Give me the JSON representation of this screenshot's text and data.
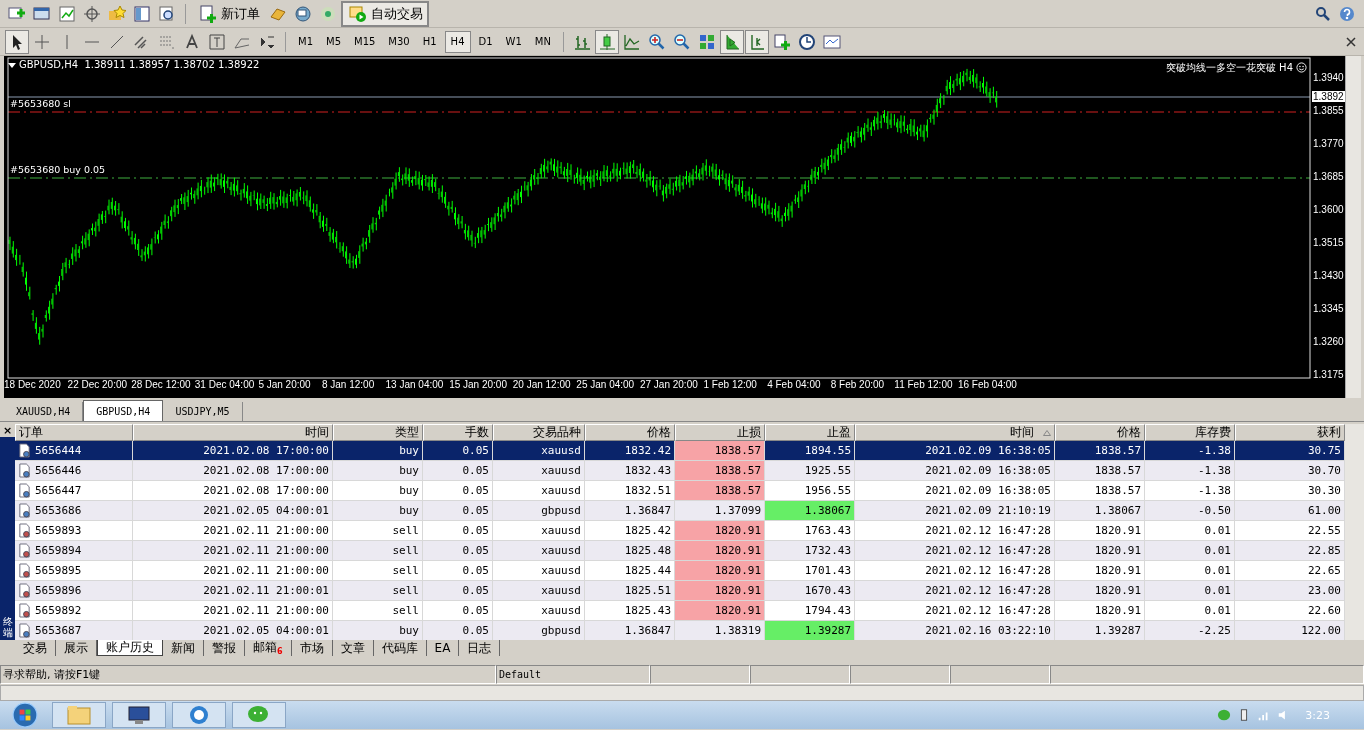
{
  "toolbar": {
    "new_order": "新订单",
    "auto_trading": {
      "label": "自动交易",
      "on": true
    }
  },
  "timeframes": [
    {
      "label": "M1",
      "selected": false
    },
    {
      "label": "M5",
      "selected": false
    },
    {
      "label": "M15",
      "selected": false
    },
    {
      "label": "M30",
      "selected": false
    },
    {
      "label": "H1",
      "selected": false
    },
    {
      "label": "H4",
      "selected": true
    },
    {
      "label": "D1",
      "selected": false
    },
    {
      "label": "W1",
      "selected": false
    },
    {
      "label": "MN",
      "selected": false
    }
  ],
  "chart": {
    "title": "GBPUSD,H4",
    "ohlc": "1.38911 1.38957 1.38702 1.38922",
    "indicator": "突破均线一多空一花突破 H4",
    "order_lines": [
      {
        "label": "#5653680 sl",
        "kind": "sl"
      },
      {
        "label": "#5653680 buy 0.05",
        "kind": "entry"
      }
    ],
    "price_labels": [
      {
        "label": "1.3940",
        "current": false
      },
      {
        "label": "1.3892",
        "current": true
      },
      {
        "label": "1.3855",
        "current": false
      },
      {
        "label": "1.3770",
        "current": false
      },
      {
        "label": "1.3685",
        "current": false
      },
      {
        "label": "1.3600",
        "current": false
      },
      {
        "label": "1.3515",
        "current": false
      },
      {
        "label": "1.3430",
        "current": false
      },
      {
        "label": "1.3345",
        "current": false
      },
      {
        "label": "1.3260",
        "current": false
      },
      {
        "label": "1.3175",
        "current": false
      }
    ],
    "time_labels": [
      "18 Dec 2020",
      "22 Dec 20:00",
      "28 Dec 12:00",
      "31 Dec 04:00",
      "5 Jan 20:00",
      "8 Jan 12:00",
      "13 Jan 04:00",
      "15 Jan 20:00",
      "20 Jan 12:00",
      "25 Jan 04:00",
      "27 Jan 20:00",
      "1 Feb 12:00",
      "4 Feb 04:00",
      "8 Feb 20:00",
      "11 Feb 12:00",
      "16 Feb 04:00"
    ]
  },
  "chart_tabs": [
    {
      "label": "XAUUSD,H4",
      "selected": false
    },
    {
      "label": "GBPUSD,H4",
      "selected": true
    },
    {
      "label": "USDJPY,M5",
      "selected": false
    }
  ],
  "terminal": {
    "close": "×",
    "label": "终端"
  },
  "table": {
    "columns": [
      {
        "label": "订单",
        "sorted": false
      },
      {
        "label": "时间",
        "sorted": false
      },
      {
        "label": "类型",
        "sorted": false
      },
      {
        "label": "手数",
        "sorted": false
      },
      {
        "label": "交易品种",
        "sorted": false
      },
      {
        "label": "价格",
        "sorted": false
      },
      {
        "label": "止损",
        "sorted": false
      },
      {
        "label": "止盈",
        "sorted": false
      },
      {
        "label": "时间",
        "sorted": true
      },
      {
        "label": "价格",
        "sorted": false
      },
      {
        "label": "库存费",
        "sorted": false
      },
      {
        "label": "获利",
        "sorted": false
      }
    ],
    "rows": [
      {
        "kind": "buy",
        "selected": true,
        "sl_hit": true,
        "tp_hit": false,
        "cells": [
          "5656444",
          "2021.02.08 17:00:00",
          "buy",
          "0.05",
          "xauusd",
          "1832.42",
          "1838.57",
          "1894.55",
          "2021.02.09 16:38:05",
          "1838.57",
          "-1.38",
          "30.75"
        ]
      },
      {
        "kind": "buy",
        "selected": false,
        "sl_hit": true,
        "tp_hit": false,
        "cells": [
          "5656446",
          "2021.02.08 17:00:00",
          "buy",
          "0.05",
          "xauusd",
          "1832.43",
          "1838.57",
          "1925.55",
          "2021.02.09 16:38:05",
          "1838.57",
          "-1.38",
          "30.70"
        ]
      },
      {
        "kind": "buy",
        "selected": false,
        "sl_hit": true,
        "tp_hit": false,
        "cells": [
          "5656447",
          "2021.02.08 17:00:00",
          "buy",
          "0.05",
          "xauusd",
          "1832.51",
          "1838.57",
          "1956.55",
          "2021.02.09 16:38:05",
          "1838.57",
          "-1.38",
          "30.30"
        ]
      },
      {
        "kind": "buy",
        "selected": false,
        "sl_hit": false,
        "tp_hit": true,
        "cells": [
          "5653686",
          "2021.02.05 04:00:01",
          "buy",
          "0.05",
          "gbpusd",
          "1.36847",
          "1.37099",
          "1.38067",
          "2021.02.09 21:10:19",
          "1.38067",
          "-0.50",
          "61.00"
        ]
      },
      {
        "kind": "sell",
        "selected": false,
        "sl_hit": true,
        "tp_hit": false,
        "cells": [
          "5659893",
          "2021.02.11 21:00:00",
          "sell",
          "0.05",
          "xauusd",
          "1825.42",
          "1820.91",
          "1763.43",
          "2021.02.12 16:47:28",
          "1820.91",
          "0.01",
          "22.55"
        ]
      },
      {
        "kind": "sell",
        "selected": false,
        "sl_hit": true,
        "tp_hit": false,
        "cells": [
          "5659894",
          "2021.02.11 21:00:00",
          "sell",
          "0.05",
          "xauusd",
          "1825.48",
          "1820.91",
          "1732.43",
          "2021.02.12 16:47:28",
          "1820.91",
          "0.01",
          "22.85"
        ]
      },
      {
        "kind": "sell",
        "selected": false,
        "sl_hit": true,
        "tp_hit": false,
        "cells": [
          "5659895",
          "2021.02.11 21:00:00",
          "sell",
          "0.05",
          "xauusd",
          "1825.44",
          "1820.91",
          "1701.43",
          "2021.02.12 16:47:28",
          "1820.91",
          "0.01",
          "22.65"
        ]
      },
      {
        "kind": "sell",
        "selected": false,
        "sl_hit": true,
        "tp_hit": false,
        "cells": [
          "5659896",
          "2021.02.11 21:00:01",
          "sell",
          "0.05",
          "xauusd",
          "1825.51",
          "1820.91",
          "1670.43",
          "2021.02.12 16:47:28",
          "1820.91",
          "0.01",
          "23.00"
        ]
      },
      {
        "kind": "sell",
        "selected": false,
        "sl_hit": true,
        "tp_hit": false,
        "cells": [
          "5659892",
          "2021.02.11 21:00:00",
          "sell",
          "0.05",
          "xauusd",
          "1825.43",
          "1820.91",
          "1794.43",
          "2021.02.12 16:47:28",
          "1820.91",
          "0.01",
          "22.60"
        ]
      },
      {
        "kind": "buy",
        "selected": false,
        "sl_hit": false,
        "tp_hit": true,
        "cells": [
          "5653687",
          "2021.02.05 04:00:01",
          "buy",
          "0.05",
          "gbpusd",
          "1.36847",
          "1.38319",
          "1.39287",
          "2021.02.16 03:22:10",
          "1.39287",
          "-2.25",
          "122.00"
        ]
      }
    ]
  },
  "bottom_tabs": [
    {
      "label": "交易",
      "selected": false
    },
    {
      "label": "展示",
      "selected": false
    },
    {
      "label": "账户历史",
      "selected": true
    },
    {
      "label": "新闻",
      "selected": false
    },
    {
      "label": "警报",
      "selected": false
    },
    {
      "label": "邮箱",
      "selected": false,
      "badge": "6"
    },
    {
      "label": "市场",
      "selected": false
    },
    {
      "label": "文章",
      "selected": false
    },
    {
      "label": "代码库",
      "selected": false
    },
    {
      "label": "EA",
      "selected": false
    },
    {
      "label": "日志",
      "selected": false
    }
  ],
  "status_bar": {
    "help": "寻求帮助, 请按F1键",
    "profile": "Default"
  },
  "taskbar": {
    "time": "3:23"
  }
}
